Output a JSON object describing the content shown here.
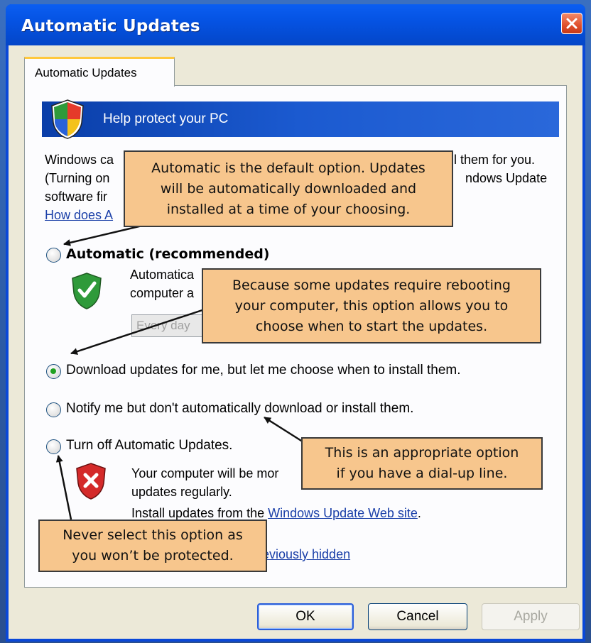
{
  "window": {
    "title": "Automatic Updates"
  },
  "tab": {
    "label": "Automatic Updates"
  },
  "banner": {
    "text": "Help protect your PC"
  },
  "intro": {
    "line1_start": "Windows ca",
    "line1_end": "ll them for you.",
    "line2_start": "(Turning on",
    "line2_end": "ndows Update",
    "line3_start": "software fir",
    "link_start": "How does A"
  },
  "options": {
    "automatic": "Automatic (recommended)",
    "automatic_desc1": "Automatica",
    "automatic_desc2": "computer a",
    "schedule_value": "Every day",
    "download": "Download updates for me, but let me choose when to install them.",
    "notify": "Notify me but don't automatically download or install them.",
    "turnoff": "Turn off Automatic Updates.",
    "turnoff_desc1": "Your computer will be mor",
    "turnoff_desc2": "updates regularly.",
    "install_prefix": "Install updates from the ",
    "install_link": "Windows Update Web site",
    "install_suffix": ".",
    "hidden_link": "eviously hidden"
  },
  "callouts": {
    "automatic": "Automatic is the default option. Updates\nwill be automatically downloaded and\ninstalled at a time of your choosing.",
    "download": "Because some updates require rebooting\nyour computer, this option allows you to\nchoose when to start the updates.",
    "notify": "This is an appropriate option\nif you have a dial-up line.",
    "turnoff": "Never select this option as\nyou won’t be protected."
  },
  "buttons": {
    "ok": "OK",
    "cancel": "Cancel",
    "apply": "Apply"
  },
  "colors": {
    "titlebar": "#0553e3",
    "callout": "#f7c68d",
    "banner": "#1b5ad0"
  }
}
